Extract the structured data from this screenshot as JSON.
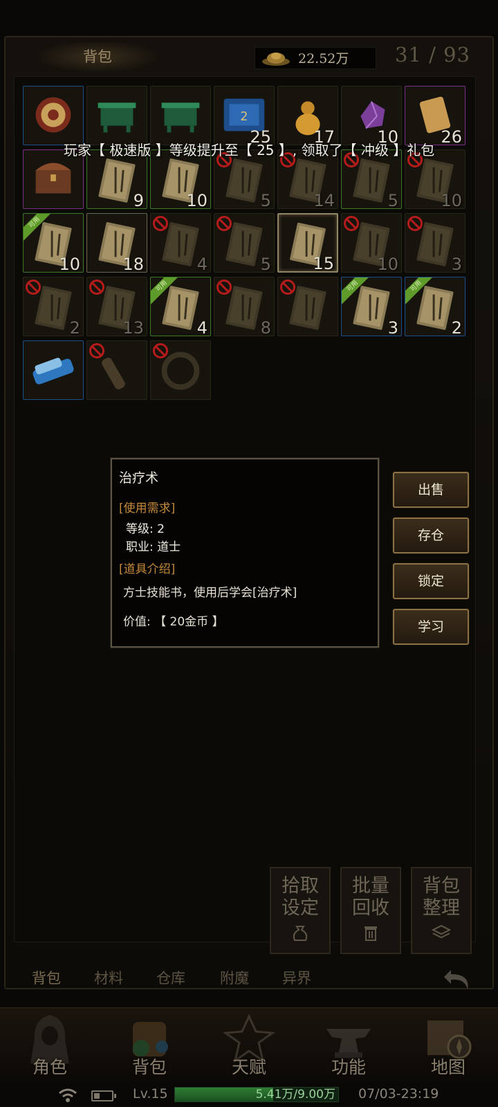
{
  "header": {
    "tab_title": "背包",
    "gold": "22.52万",
    "capacity": "31 / 93"
  },
  "announcement": "玩家【 极速版 】等级提升至【 25 】, 领取了【 冲级 】礼包",
  "usable_label": "可用",
  "items": [
    {
      "id": "r1c1",
      "icon": "gear-medallion",
      "quality": "blue",
      "count": "",
      "blocked": false,
      "usable": false
    },
    {
      "id": "r1c2",
      "icon": "green-chest",
      "quality": "none",
      "count": "",
      "blocked": false,
      "usable": false
    },
    {
      "id": "r1c3",
      "icon": "green-chest",
      "quality": "none",
      "count": "",
      "blocked": false,
      "usable": false
    },
    {
      "id": "r1c4",
      "icon": "scroll",
      "quality": "none",
      "count": "25",
      "blocked": false,
      "usable": false
    },
    {
      "id": "r1c5",
      "icon": "gourd",
      "quality": "none",
      "count": "17",
      "blocked": false,
      "usable": false
    },
    {
      "id": "r1c6",
      "icon": "purple-gem",
      "quality": "none",
      "count": "10",
      "blocked": false,
      "usable": false
    },
    {
      "id": "r1c7",
      "icon": "paper-scroll",
      "quality": "purple",
      "count": "26",
      "blocked": false,
      "usable": false
    },
    {
      "id": "r2c1",
      "icon": "treasure-chest",
      "quality": "purple",
      "count": "",
      "blocked": false,
      "usable": false
    },
    {
      "id": "r2c2",
      "icon": "skill-book",
      "quality": "green",
      "count": "9",
      "blocked": false,
      "usable": false
    },
    {
      "id": "r2c3",
      "icon": "skill-book",
      "quality": "green",
      "count": "10",
      "blocked": false,
      "usable": false
    },
    {
      "id": "r2c4",
      "icon": "skill-book",
      "quality": "none",
      "count": "5",
      "blocked": true,
      "usable": false
    },
    {
      "id": "r2c5",
      "icon": "skill-book",
      "quality": "none",
      "count": "14",
      "blocked": true,
      "usable": false
    },
    {
      "id": "r2c6",
      "icon": "skill-book",
      "quality": "green",
      "count": "5",
      "blocked": true,
      "usable": false
    },
    {
      "id": "r2c7",
      "icon": "skill-book",
      "quality": "none",
      "count": "10",
      "blocked": true,
      "usable": false
    },
    {
      "id": "r3c1",
      "icon": "skill-book",
      "quality": "green",
      "count": "10",
      "blocked": false,
      "usable": true
    },
    {
      "id": "r3c2",
      "icon": "skill-book",
      "quality": "white",
      "count": "18",
      "blocked": false,
      "usable": false
    },
    {
      "id": "r3c3",
      "icon": "skill-book",
      "quality": "none",
      "count": "4",
      "blocked": true,
      "usable": false
    },
    {
      "id": "r3c4",
      "icon": "skill-book",
      "quality": "none",
      "count": "5",
      "blocked": true,
      "usable": false
    },
    {
      "id": "r3c5",
      "icon": "skill-book",
      "quality": "white",
      "count": "15",
      "blocked": false,
      "usable": false,
      "selected": true
    },
    {
      "id": "r3c6",
      "icon": "skill-book",
      "quality": "none",
      "count": "10",
      "blocked": true,
      "usable": false
    },
    {
      "id": "r3c7",
      "icon": "skill-book",
      "quality": "none",
      "count": "3",
      "blocked": true,
      "usable": false
    },
    {
      "id": "r4c1",
      "icon": "skill-book",
      "quality": "none",
      "count": "2",
      "blocked": true,
      "usable": false
    },
    {
      "id": "r4c2",
      "icon": "skill-book",
      "quality": "none",
      "count": "13",
      "blocked": true,
      "usable": false
    },
    {
      "id": "r4c3",
      "icon": "skill-book",
      "quality": "green",
      "count": "4",
      "blocked": false,
      "usable": true
    },
    {
      "id": "r4c4",
      "icon": "skill-book",
      "quality": "none",
      "count": "8",
      "blocked": true,
      "usable": false
    },
    {
      "id": "r4c5",
      "icon": "skill-book",
      "quality": "none",
      "count": "",
      "blocked": true,
      "usable": false
    },
    {
      "id": "r4c6",
      "icon": "skill-book",
      "quality": "blue",
      "count": "3",
      "blocked": false,
      "usable": true
    },
    {
      "id": "r4c7",
      "icon": "skill-book",
      "quality": "blue",
      "count": "2",
      "blocked": false,
      "usable": true
    },
    {
      "id": "r5c1",
      "icon": "blue-cloth",
      "quality": "blue",
      "count": "",
      "blocked": false,
      "usable": false
    },
    {
      "id": "r5c2",
      "icon": "rope-bundle",
      "quality": "none",
      "count": "",
      "blocked": true,
      "usable": false
    },
    {
      "id": "r5c3",
      "icon": "dark-ring",
      "quality": "none",
      "count": "",
      "blocked": true,
      "usable": false
    }
  ],
  "tooltip": {
    "name": "治疗术",
    "req_header": "[使用需求]",
    "level": "等级: 2",
    "job": "职业: 道士",
    "intro_header": "[道具介绍]",
    "description": "方士技能书，使用后学会[治疗术]",
    "value": "价值: 【 20金币 】"
  },
  "actions": {
    "sell": "出售",
    "store": "存仓",
    "lock": "锁定",
    "learn": "学习"
  },
  "tools": {
    "pickup_line1": "拾取",
    "pickup_line2": "设定",
    "recycle_line1": "批量",
    "recycle_line2": "回收",
    "sort_line1": "背包",
    "sort_line2": "整理"
  },
  "sub_tabs": [
    "背包",
    "材料",
    "仓库",
    "附魔",
    "异界"
  ],
  "bottom_nav": [
    "角色",
    "背包",
    "天赋",
    "功能",
    "地图"
  ],
  "status": {
    "level": "Lv.15",
    "exp": "5.41万/9.00万",
    "exp_fraction": 0.601,
    "battery_fraction": 0.35,
    "datetime": "07/03-23:19"
  },
  "colors": {
    "quality_blue": "#1e4e88",
    "quality_green": "#3a7a26",
    "quality_purple": "#7a2f82",
    "section_header": "#c48a3a",
    "forbidden_red": "#b61b1b"
  }
}
